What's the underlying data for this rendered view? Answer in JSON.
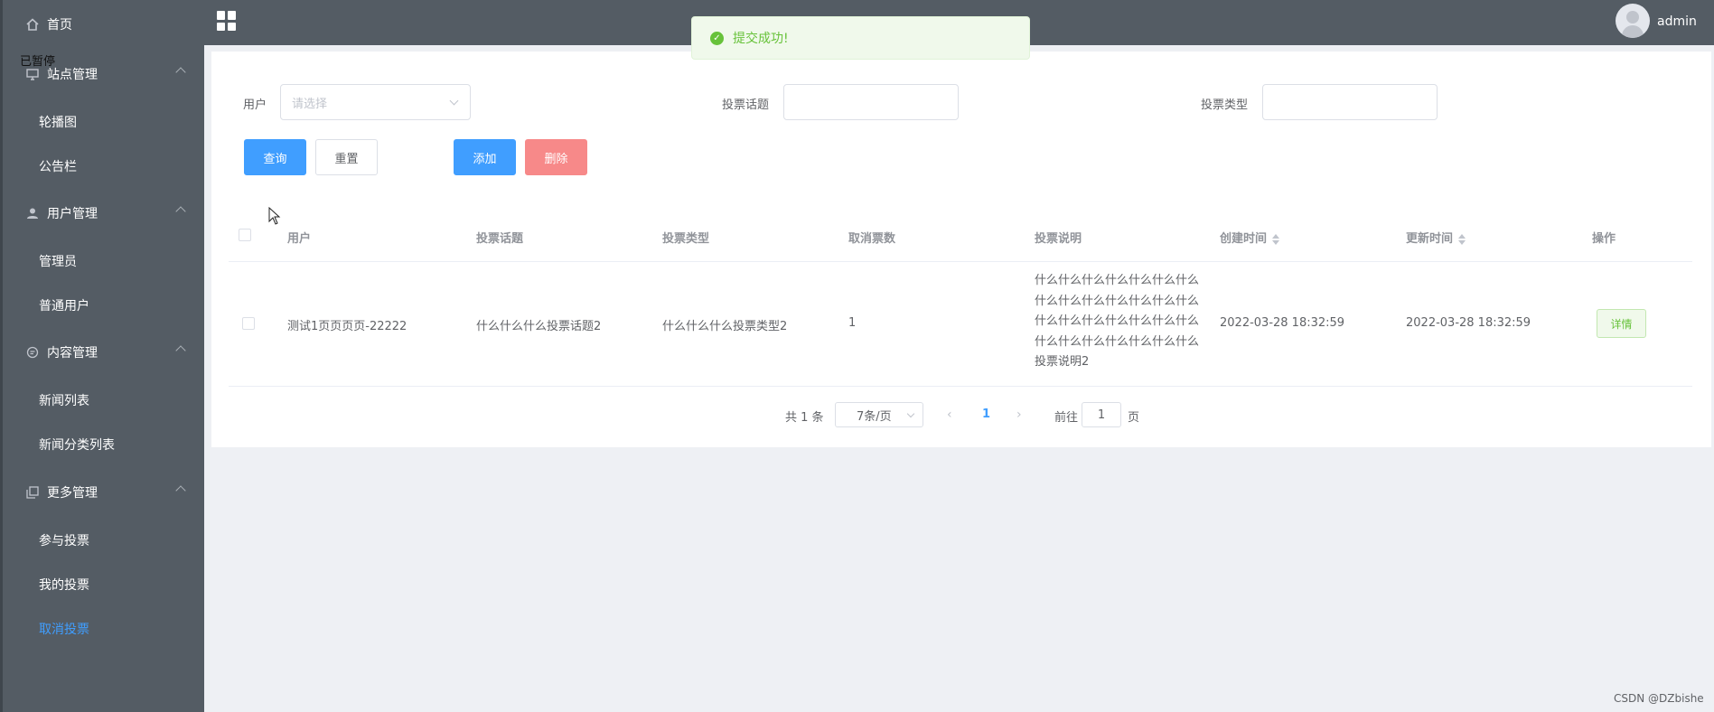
{
  "header": {
    "title": "",
    "user": "admin"
  },
  "overlay": {
    "paused_label": "已暂停"
  },
  "toast": {
    "message": "提交成功!"
  },
  "sidebar": {
    "home": "首页",
    "groups": [
      {
        "label": "站点管理",
        "items": [
          "轮播图",
          "公告栏"
        ]
      },
      {
        "label": "用户管理",
        "items": [
          "管理员",
          "普通用户"
        ]
      },
      {
        "label": "内容管理",
        "items": [
          "新闻列表",
          "新闻分类列表"
        ]
      },
      {
        "label": "更多管理",
        "items": [
          "参与投票",
          "我的投票",
          "取消投票"
        ]
      }
    ],
    "active_item": "取消投票"
  },
  "search": {
    "user_label": "用户",
    "user_placeholder": "请选择",
    "topic_label": "投票话题",
    "type_label": "投票类型"
  },
  "buttons": {
    "query": "查询",
    "reset": "重置",
    "add": "添加",
    "delete": "删除",
    "detail": "详情"
  },
  "table": {
    "columns": [
      "用户",
      "投票话题",
      "投票类型",
      "取消票数",
      "投票说明",
      "创建时间",
      "更新时间",
      "操作"
    ],
    "rows": [
      {
        "user": "测试1页页页页-22222",
        "topic": "什么什么什么投票话题2",
        "type": "什么什么什么投票类型2",
        "count": "1",
        "desc": "什么什么什么什么什么什么什么什么什么什么什么什么什么什么什么什么什么什么什么什么什么什么什么什么什么什么什么什么投票说明2",
        "created": "2022-03-28 18:32:59",
        "updated": "2022-03-28 18:32:59"
      }
    ]
  },
  "pagination": {
    "total_text": "共 1 条",
    "page_size": "7条/页",
    "current": "1",
    "goto_label": "前往",
    "goto_value": "1",
    "page_suffix": "页"
  },
  "watermark": "CSDN @DZbishe"
}
